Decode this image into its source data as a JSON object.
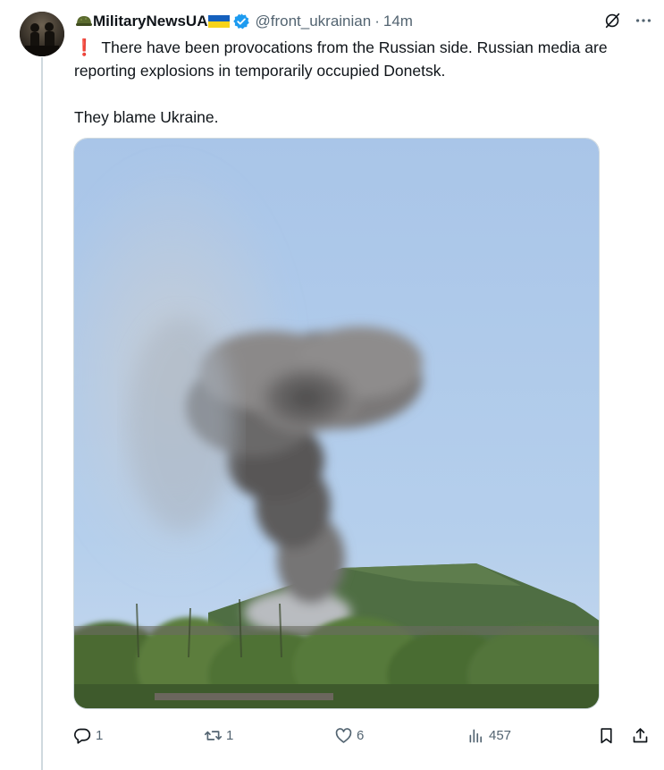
{
  "tweet": {
    "display_name": "MilitaryNewsUA",
    "handle": "@front_ukrainian",
    "separator": "·",
    "time": "14m",
    "text_line1": "There have been provocations from the Russian side. Russian media are reporting explosions in temporarily occupied Donetsk.",
    "text_line2": "They blame Ukraine.",
    "prefix_icon": "red-exclamation-icon",
    "name_emojis": [
      "military-helmet-icon",
      "ukraine-flag-icon"
    ],
    "media_description_icon": "smoke-explosion-photo"
  },
  "actions": {
    "replies": "1",
    "reposts": "1",
    "likes": "6",
    "views": "457"
  },
  "colors": {
    "text": "#0f1419",
    "secondary": "#536471",
    "verified": "#1d9bf0",
    "accent_red": "#e0245e",
    "thread_line": "#cfd9de"
  }
}
